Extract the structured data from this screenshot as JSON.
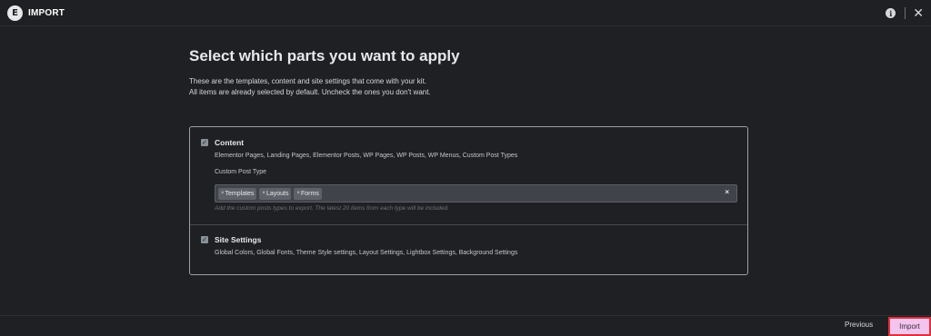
{
  "header": {
    "logo_letter": "E",
    "title": "IMPORT",
    "info_icon": "info-icon",
    "close_icon": "close-icon"
  },
  "main": {
    "title": "Select which parts you want to apply",
    "description_line1": "These are the templates, content and site settings that come with your kit.",
    "description_line2": "All items are already selected by default. Uncheck the ones you don't want."
  },
  "content_section": {
    "checked": true,
    "title": "Content",
    "description": "Elementor Pages, Landing Pages, Elementor Posts, WP Pages, WP Posts, WP Menus, Custom Post Types",
    "custom_post_type_label": "Custom Post Type",
    "selected_types": [
      "Templates",
      "Layouts",
      "Forms"
    ],
    "hint": "Add the custom posts types to export. The latest 20 items from each type will be included."
  },
  "site_settings_section": {
    "checked": true,
    "title": "Site Settings",
    "description": "Global Colors, Global Fonts, Theme Style settings, Layout Settings, Lightbox Settings, Background Settings"
  },
  "footer": {
    "previous_label": "Previous",
    "import_label": "Import"
  },
  "colors": {
    "background": "#1f2024",
    "import_button": "#f2c4ee",
    "highlight_border": "#e0313c"
  }
}
